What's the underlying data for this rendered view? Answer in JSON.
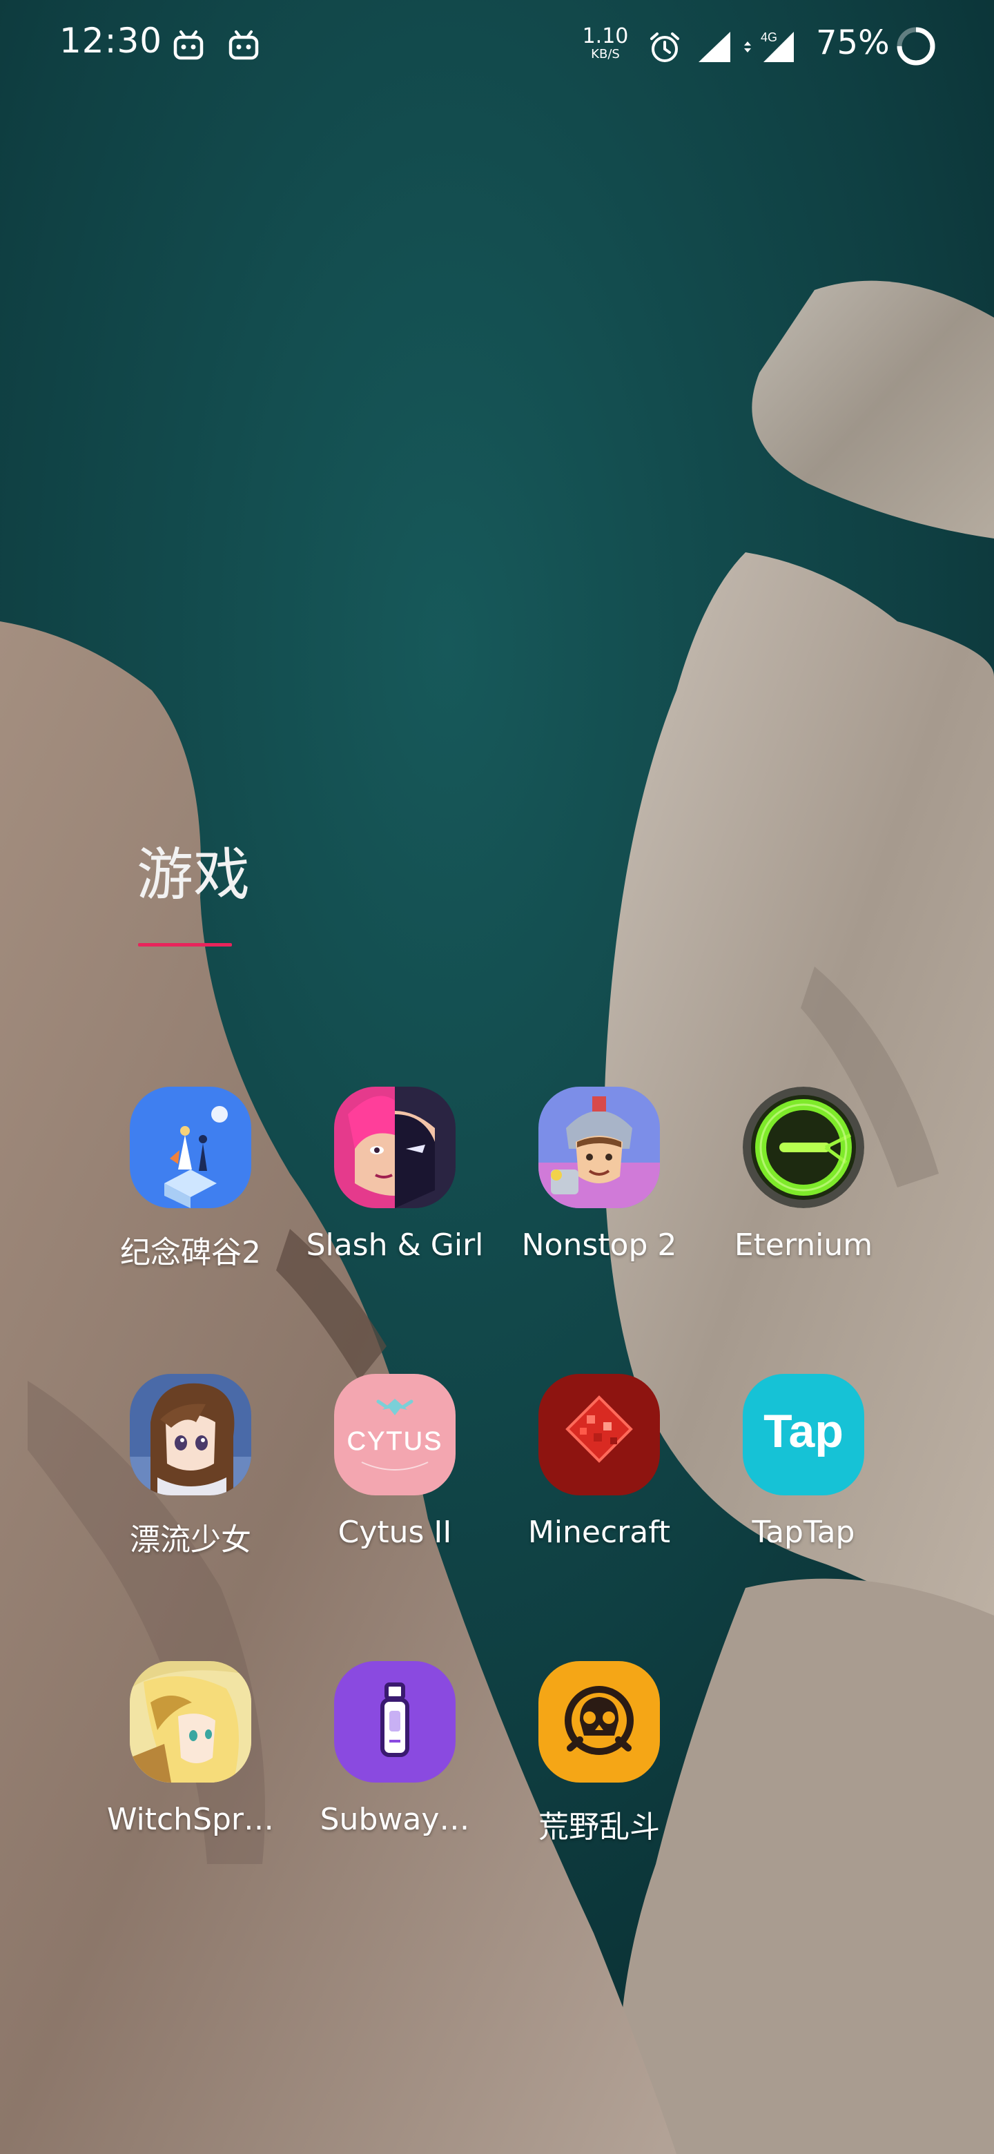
{
  "status_bar": {
    "time": "12:30",
    "notification_icons": [
      "bilibili-icon",
      "bilibili-icon"
    ],
    "net_speed": "1.10",
    "net_speed_unit": "KB/S",
    "alarm_icon": "alarm-icon",
    "signal_icons": [
      "signal-icon",
      "signal-4g-icon"
    ],
    "network_label": "4G",
    "battery": "75%"
  },
  "folder": {
    "title": "游戏",
    "accent_color": "#e8245b"
  },
  "apps": [
    {
      "label": "纪念碑谷2",
      "icon": "monument-valley-2-icon"
    },
    {
      "label": "Slash & Girl",
      "icon": "slash-and-girl-icon"
    },
    {
      "label": "Nonstop 2",
      "icon": "nonstop-2-icon"
    },
    {
      "label": "Eternium",
      "icon": "eternium-icon"
    },
    {
      "label": "漂流少女",
      "icon": "piaoliu-shaonv-icon"
    },
    {
      "label": "Cytus II",
      "icon": "cytus-2-icon",
      "icon_text": "CYTUS"
    },
    {
      "label": "Minecraft",
      "icon": "minecraft-icon"
    },
    {
      "label": "TapTap",
      "icon": "taptap-icon",
      "icon_text": "Tap"
    },
    {
      "label": "WitchSpr…",
      "icon": "witchspring-icon"
    },
    {
      "label": "Subway…",
      "icon": "subway-surfers-icon"
    },
    {
      "label": "荒野乱斗",
      "icon": "brawl-stars-icon"
    }
  ]
}
